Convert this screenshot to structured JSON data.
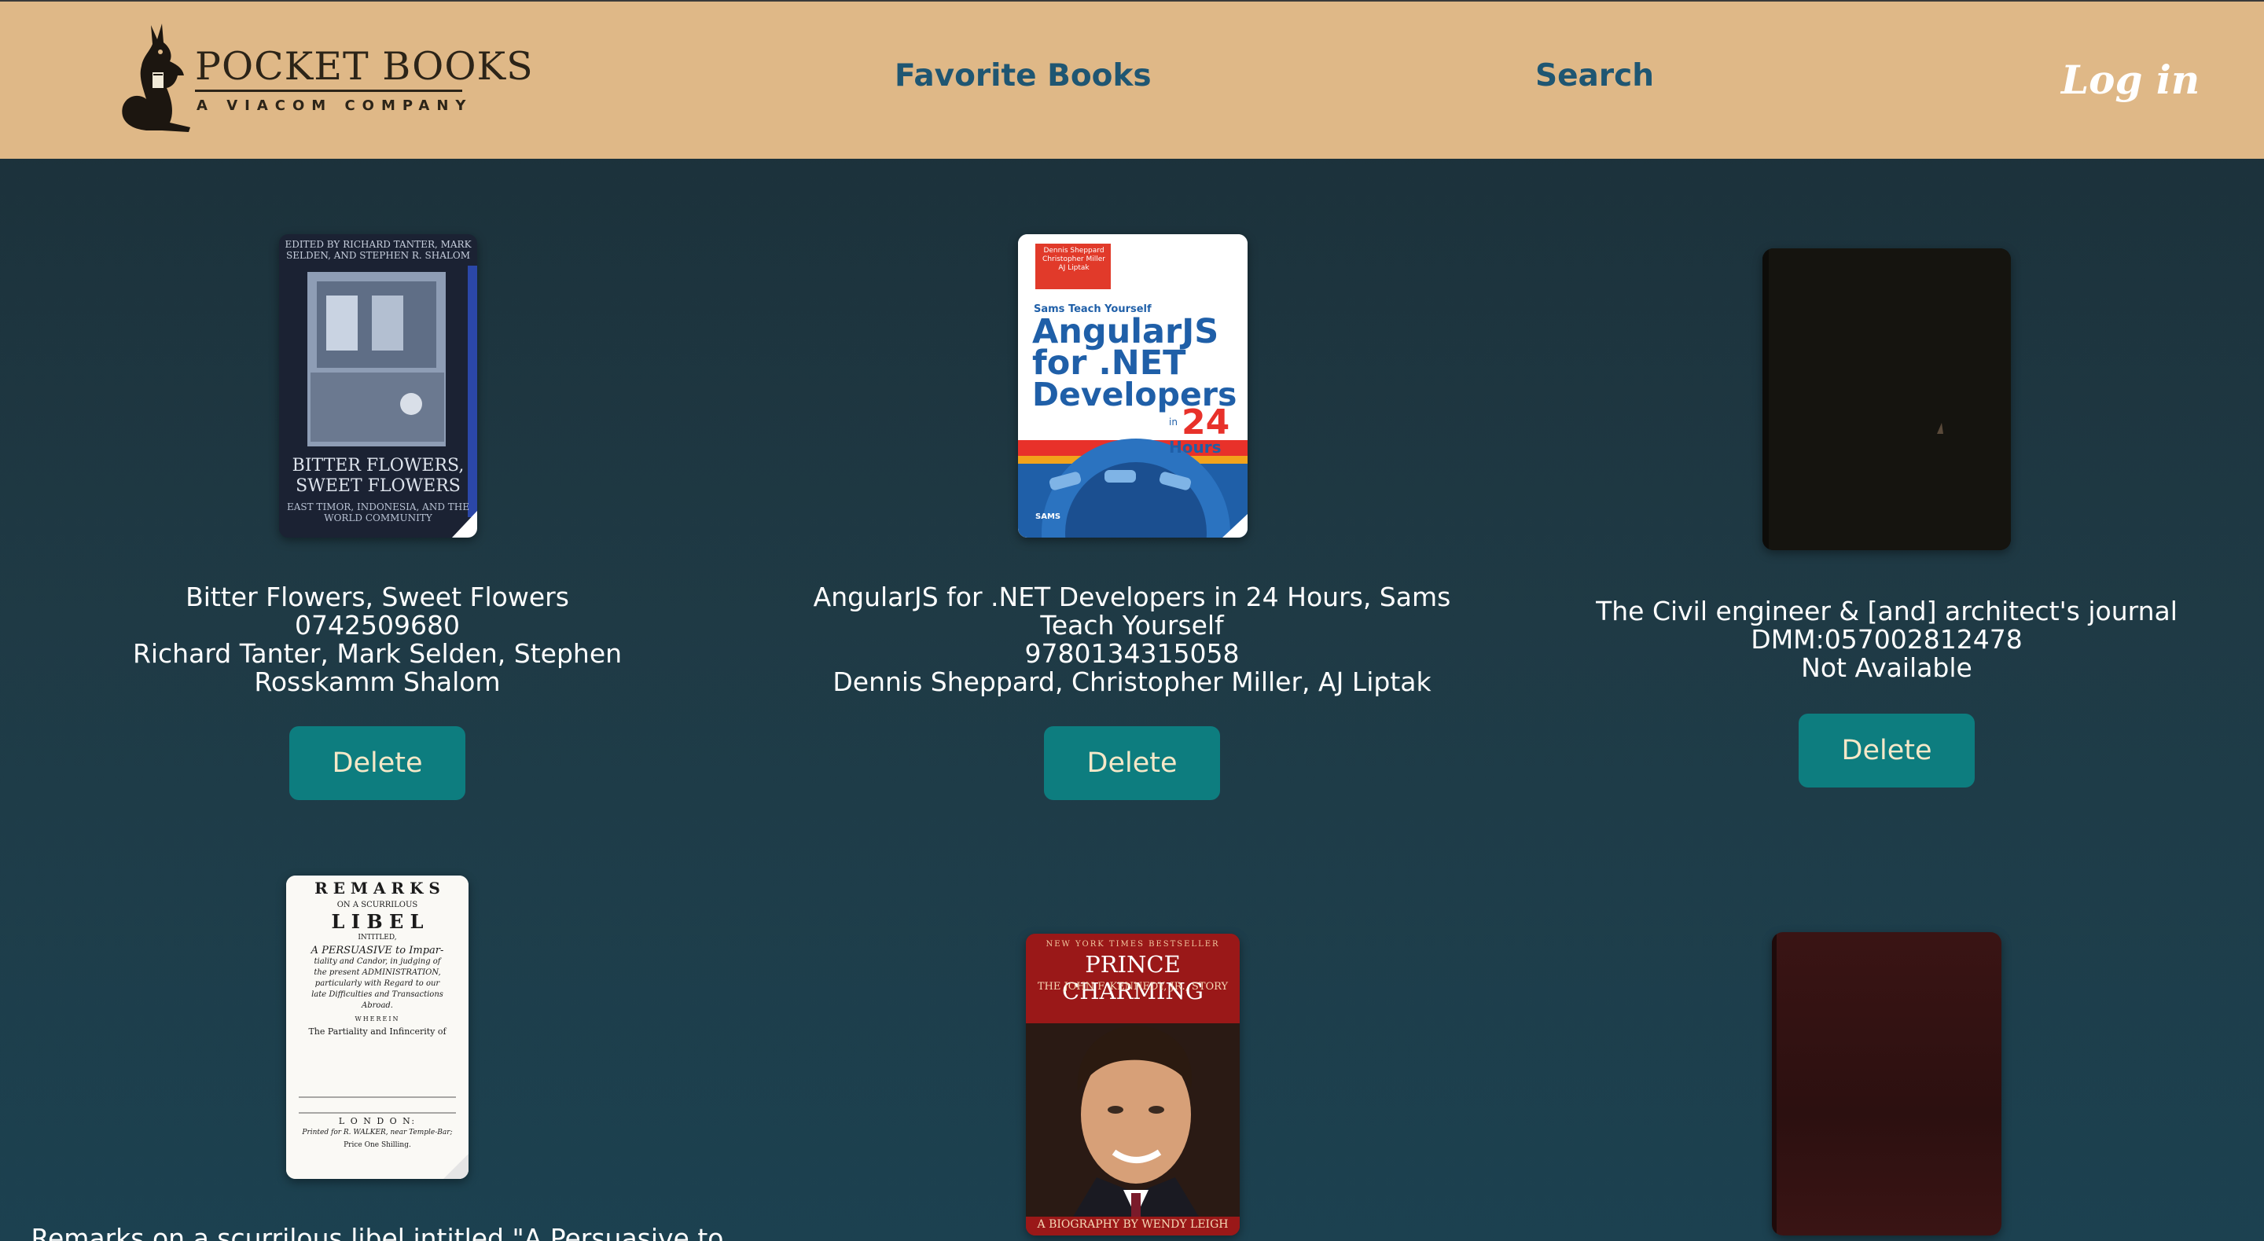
{
  "header": {
    "logo_title": "POCKET BOOKS",
    "logo_subtitle": "A VIACOM COMPANY",
    "nav": {
      "favorites": "Favorite Books",
      "search": "Search",
      "login": "Log in"
    }
  },
  "colors": {
    "navbar": "#dfb887",
    "nav_link": "#1f5672",
    "delete_button": "#0d7d7f",
    "delete_text": "#f5e8c8"
  },
  "books": [
    {
      "title": "Bitter Flowers, Sweet Flowers",
      "isbn": "0742509680",
      "authors": "Richard Tanter, Mark Selden, Stephen Rosskamm Shalom",
      "delete_label": "Delete",
      "cover": {
        "editors": "EDITED BY RICHARD TANTER, MARK SELDEN, AND STEPHEN R. SHALOM",
        "title_line1": "BITTER FLOWERS,",
        "title_line2": "SWEET FLOWERS",
        "subtitle": "EAST TIMOR, INDONESIA, AND THE WORLD COMMUNITY"
      }
    },
    {
      "title": "AngularJS for .NET Developers in 24 Hours, Sams Teach Yourself",
      "isbn": "9780134315058",
      "authors": "Dennis Sheppard, Christopher Miller, AJ Liptak",
      "delete_label": "Delete",
      "cover": {
        "authors_box": "Dennis Sheppard Christopher Miller AJ Liptak",
        "series": "Sams Teach Yourself",
        "line1": "AngularJS",
        "line2": "for .NET",
        "line3": "Developers",
        "in_label": "in",
        "hours_num": "24",
        "hours_label": "Hours",
        "publisher": "SAMS"
      }
    },
    {
      "title": "The Civil engineer & [and] architect's journal",
      "isbn": "DMM:057002812478",
      "authors": "Not Available",
      "delete_label": "Delete"
    },
    {
      "title": "Remarks on a scurrilous libel intitled \"A Persuasive to",
      "cover": {
        "line1": "R E M A R K S",
        "line2": "ON A SCURRILOUS",
        "line3": "L I B E L",
        "line4": "INTITLED,",
        "line5": "A PERSUASIVE to Impar-",
        "line6": "tiality and Candor, in judging of",
        "line7": "the present ADMINISTRATION,",
        "line8": "particularly with Regard to our",
        "line9": "late Difficulties and Transactions",
        "line10": "Abroad.",
        "line11": "WHEREIN",
        "line12": "The Partiality and Infincerity of",
        "line13": "L O N D O N:",
        "line14": "Printed for R. WALKER, near Temple-Bar;",
        "line15": "Price One Shilling."
      }
    },
    {
      "cover": {
        "banner": "NEW YORK TIMES BESTSELLER",
        "title": "PRINCE CHARMING",
        "subtitle": "THE JOHN F. KENNEDY, JR., STORY",
        "byline": "A BIOGRAPHY BY WENDY LEIGH"
      }
    },
    {}
  ]
}
